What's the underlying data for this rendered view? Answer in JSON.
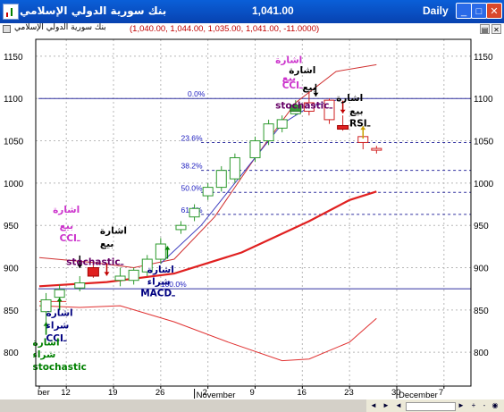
{
  "window": {
    "title": "بنك سورية الدولي الإسلامي",
    "last_price": "1,041.00",
    "period": "Daily",
    "buttons": {
      "minimize": "_",
      "maximize": "□",
      "close": "✕"
    }
  },
  "infobar": {
    "name": "بنك سورية الدولي الإسلامي",
    "ohlc": "(1,040.00, 1,044.00, 1,035.00, 1,041.00, -11.0000)"
  },
  "chart_data": {
    "type": "candlestick",
    "ylim": [
      760,
      1170
    ],
    "y_ticks": [
      "1150",
      "1100",
      "1050",
      "1000",
      "950",
      "900",
      "850",
      "800"
    ],
    "x_ticks": [
      {
        "label": "ber",
        "day": 0
      },
      {
        "label": "12",
        "day": 4
      },
      {
        "label": "19",
        "day": 11
      },
      {
        "label": "26",
        "day": 18
      },
      {
        "label": "2",
        "day": 25
      },
      {
        "label": "9",
        "day": 32
      },
      {
        "label": "16",
        "day": 39
      },
      {
        "label": "23",
        "day": 46
      },
      {
        "label": "30",
        "day": 53
      },
      {
        "label": "7",
        "day": 60
      }
    ],
    "month_labels": [
      {
        "label": "November",
        "day": 23
      },
      {
        "label": "December",
        "day": 53
      }
    ],
    "candles": [
      {
        "day": 1,
        "o": 848,
        "h": 870,
        "l": 835,
        "c": 862,
        "up": true
      },
      {
        "day": 3,
        "o": 865,
        "h": 880,
        "l": 860,
        "c": 874,
        "up": true
      },
      {
        "day": 6,
        "o": 876,
        "h": 890,
        "l": 872,
        "c": 882,
        "up": true
      },
      {
        "day": 8,
        "o": 900,
        "h": 905,
        "l": 888,
        "c": 893,
        "up": false
      },
      {
        "day": 12,
        "o": 885,
        "h": 900,
        "l": 878,
        "c": 890,
        "up": true
      },
      {
        "day": 14,
        "o": 885,
        "h": 900,
        "l": 880,
        "c": 897,
        "up": true
      },
      {
        "day": 16,
        "o": 895,
        "h": 915,
        "l": 890,
        "c": 910,
        "up": true
      },
      {
        "day": 18,
        "o": 910,
        "h": 935,
        "l": 905,
        "c": 928,
        "up": true
      },
      {
        "day": 21,
        "o": 945,
        "h": 955,
        "l": 940,
        "c": 950,
        "up": true
      },
      {
        "day": 23,
        "o": 960,
        "h": 975,
        "l": 955,
        "c": 970,
        "up": true
      },
      {
        "day": 25,
        "o": 985,
        "h": 1000,
        "l": 980,
        "c": 995,
        "up": true
      },
      {
        "day": 27,
        "o": 995,
        "h": 1020,
        "l": 990,
        "c": 1015,
        "up": true
      },
      {
        "day": 29,
        "o": 1005,
        "h": 1035,
        "l": 1000,
        "c": 1030,
        "up": true
      },
      {
        "day": 32,
        "o": 1030,
        "h": 1055,
        "l": 1025,
        "c": 1050,
        "up": true
      },
      {
        "day": 34,
        "o": 1050,
        "h": 1075,
        "l": 1045,
        "c": 1070,
        "up": true
      },
      {
        "day": 36,
        "o": 1065,
        "h": 1080,
        "l": 1060,
        "c": 1075,
        "up": true
      },
      {
        "day": 38,
        "o": 1082,
        "h": 1098,
        "l": 1080,
        "c": 1092,
        "up": true
      },
      {
        "day": 40,
        "o": 1095,
        "h": 1108,
        "l": 1080,
        "c": 1085,
        "up": false
      },
      {
        "day": 43,
        "o": 1098,
        "h": 1100,
        "l": 1070,
        "c": 1075,
        "up": false
      },
      {
        "day": 45,
        "o": 1068,
        "h": 1080,
        "l": 1062,
        "c": 1065,
        "up": false
      },
      {
        "day": 48,
        "o": 1055,
        "h": 1060,
        "l": 1040,
        "c": 1048,
        "up": false
      },
      {
        "day": 50,
        "o": 1040,
        "h": 1044,
        "l": 1035,
        "c": 1041,
        "up": false
      }
    ],
    "fib_levels": [
      {
        "label": "0.0%",
        "value": 1100
      },
      {
        "label": "23.6%",
        "value": 1048
      },
      {
        "label": "38.2%",
        "value": 1015
      },
      {
        "label": "50.0%",
        "value": 989
      },
      {
        "label": "61.8%",
        "value": 963
      },
      {
        "label": "100.0%",
        "value": 875
      }
    ],
    "ma_long": [
      [
        0,
        878
      ],
      [
        10,
        883
      ],
      [
        20,
        893
      ],
      [
        30,
        918
      ],
      [
        40,
        955
      ],
      [
        46,
        980
      ],
      [
        50,
        990
      ]
    ],
    "ma_short": [
      [
        0,
        912
      ],
      [
        8,
        906
      ],
      [
        14,
        900
      ],
      [
        20,
        910
      ],
      [
        26,
        960
      ],
      [
        32,
        1030
      ],
      [
        38,
        1095
      ],
      [
        44,
        1132
      ],
      [
        50,
        1140
      ]
    ],
    "ma_mid": [
      [
        18,
        905
      ],
      [
        24,
        950
      ],
      [
        30,
        1010
      ],
      [
        36,
        1070
      ],
      [
        40,
        1090
      ],
      [
        44,
        1098
      ]
    ],
    "band_lower": [
      [
        0,
        855
      ],
      [
        6,
        853
      ],
      [
        12,
        855
      ],
      [
        20,
        836
      ],
      [
        28,
        812
      ],
      [
        36,
        790
      ],
      [
        40,
        792
      ],
      [
        46,
        812
      ],
      [
        50,
        840
      ]
    ],
    "band_upper_tail": [
      [
        0,
        860
      ],
      [
        4,
        860
      ]
    ]
  },
  "annotations": [
    {
      "id": "sell-stoch-top-1",
      "text": "اشارة",
      "color": "#cc33cc"
    },
    {
      "id": "sell-stoch-top-2",
      "text": "بيع",
      "color": "#cc33cc"
    },
    {
      "id": "sell-cci-1",
      "text": "اشارة",
      "color": "#000000"
    },
    {
      "id": "sell-cci-2",
      "text": "بيع",
      "color": "#000000"
    },
    {
      "id": "sell-cci-3",
      "text": "CCIـ",
      "color": "#cc33cc"
    },
    {
      "id": "sell-stochastic",
      "text": "stochasticـ",
      "color": "#660066"
    },
    {
      "id": "sell-rsi-1",
      "text": "اشارة",
      "color": "#000000"
    },
    {
      "id": "sell-rsi-2",
      "text": "بيع",
      "color": "#000000"
    },
    {
      "id": "sell-rsi-3",
      "text": "RSIـ",
      "color": "#000000"
    },
    {
      "id": "early-sell-stoch-1",
      "text": "اشارة",
      "color": "#cc33cc"
    },
    {
      "id": "early-sell-stoch-2",
      "text": "بيع",
      "color": "#cc33cc"
    },
    {
      "id": "early-sell-cci-3",
      "text": "CCIـ",
      "color": "#cc33cc"
    },
    {
      "id": "early-sell-cci-1",
      "text": "اشارة",
      "color": "#000000"
    },
    {
      "id": "early-sell-cci-2",
      "text": "بيع",
      "color": "#000000"
    },
    {
      "id": "early-stochastic",
      "text": "stochasticـ",
      "color": "#660066"
    },
    {
      "id": "buy-macd-1",
      "text": "اشارة",
      "color": "#000080"
    },
    {
      "id": "buy-macd-2",
      "text": "شراء",
      "color": "#000080"
    },
    {
      "id": "buy-macd-3",
      "text": "MACDـ",
      "color": "#000080"
    },
    {
      "id": "buy-cci-1",
      "text": "اشارة",
      "color": "#000080"
    },
    {
      "id": "buy-cci-2",
      "text": "شراء",
      "color": "#000080"
    },
    {
      "id": "buy-cci-3",
      "text": "CCIـ",
      "color": "#000080"
    },
    {
      "id": "buy-stoch-1",
      "text": "اشارة",
      "color": "#008000"
    },
    {
      "id": "buy-stoch-2",
      "text": "شراء",
      "color": "#008000"
    },
    {
      "id": "buy-stoch-3",
      "text": "stochastic",
      "color": "#008000"
    }
  ],
  "scrollbar": {
    "icons": [
      "◄",
      "►",
      "◄",
      "►",
      "+",
      "-",
      "◉",
      "▼"
    ]
  }
}
